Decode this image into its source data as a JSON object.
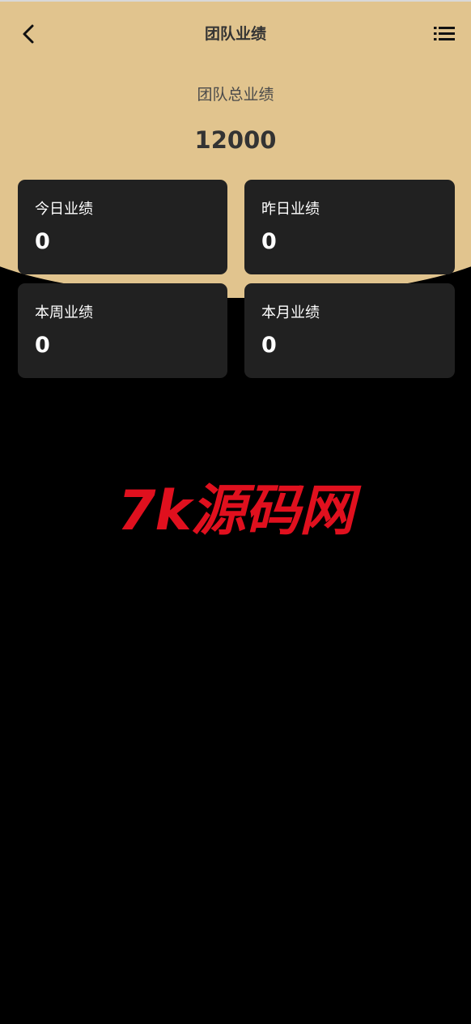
{
  "header": {
    "title": "团队业绩",
    "back_icon": "chevron-left-icon",
    "menu_icon": "list-icon"
  },
  "summary": {
    "label": "团队总业绩",
    "value": "12000"
  },
  "cards": [
    {
      "label": "今日业绩",
      "value": "0"
    },
    {
      "label": "昨日业绩",
      "value": "0"
    },
    {
      "label": "本周业绩",
      "value": "0"
    },
    {
      "label": "本月业绩",
      "value": "0"
    }
  ],
  "watermark": "7k源码网",
  "colors": {
    "hero_background": "#e1c48e",
    "page_background": "#000000",
    "card_background": "#212121",
    "watermark": "#e0101e"
  }
}
